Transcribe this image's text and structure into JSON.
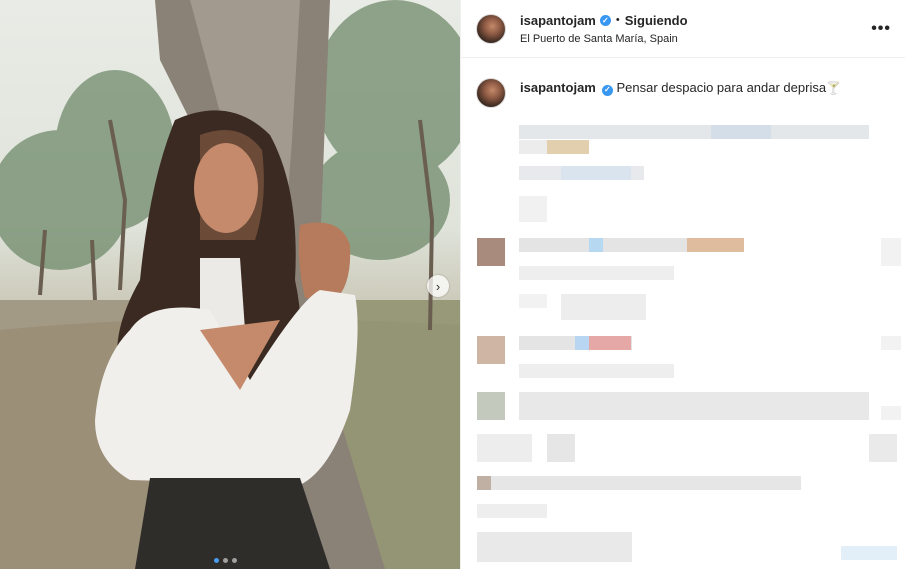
{
  "header": {
    "username": "isapantojam",
    "separator": "•",
    "follow_status": "Siguiendo",
    "location": "El Puerto de Santa María, Spain",
    "more_icon": "more-horizontal-icon"
  },
  "caption": {
    "username": "isapantojam",
    "text": "Pensar despacio para andar deprisa",
    "emoji": "🍸"
  },
  "carousel": {
    "next_glyph": "›",
    "dots": 3,
    "active_index": 0
  },
  "colors": {
    "verified": "#3897f0",
    "active_dot": "#4a9bef"
  }
}
